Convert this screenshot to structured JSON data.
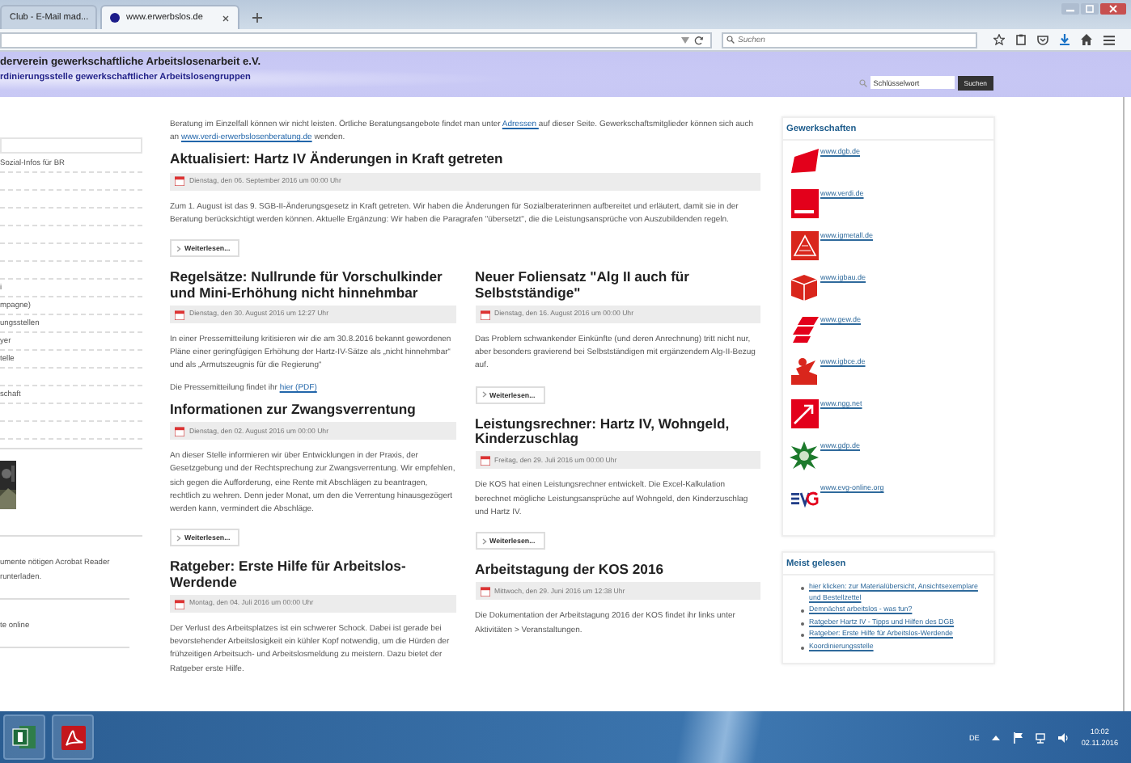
{
  "browser": {
    "tabs": [
      {
        "title": "Club - E-Mail mad...",
        "selected": false
      },
      {
        "title": "www.erwerbslos.de",
        "selected": true
      }
    ],
    "search": {
      "placeholder": "Suchen"
    }
  },
  "header": {
    "title": "derverein gewerkschaftliche Arbeitslosenarbeit e.V.",
    "subtitle": "rdinierungsstelle gewerkschaftlicher Arbeitslosengruppen",
    "search": {
      "value": "Schlüsselwort",
      "button": "Suchen"
    }
  },
  "sidebar": {
    "items": [
      {
        "kind": "field"
      },
      {
        "kind": "link",
        "text": "Sozial-Infos für BR"
      },
      {
        "kind": "blank"
      },
      {
        "kind": "blank"
      },
      {
        "kind": "blank"
      },
      {
        "kind": "blank"
      },
      {
        "kind": "blank"
      },
      {
        "kind": "blank"
      },
      {
        "kind": "link",
        "text": "i"
      },
      {
        "kind": "link",
        "text": "mpagne)"
      },
      {
        "kind": "link",
        "text": "ungsstellen"
      },
      {
        "kind": "link",
        "text": "yer"
      },
      {
        "kind": "link",
        "text": "telle"
      },
      {
        "kind": "blank"
      },
      {
        "kind": "link",
        "text": "schaft"
      },
      {
        "kind": "blank"
      },
      {
        "kind": "blank"
      },
      {
        "kind": "picture"
      },
      {
        "kind": "text",
        "text": "umente nötigen Acrobat Reader runterladen."
      },
      {
        "kind": "text",
        "text": "te online"
      }
    ]
  },
  "intro": [
    {
      "kind": "text",
      "text": "Beratung im Einzelfall können wir nicht leisten. Örtliche Beratungsangebote findet man unter "
    },
    {
      "kind": "link",
      "text": "Adressen "
    },
    {
      "kind": "text",
      "text": "auf dieser Seite. Gewerkschaftsmitglieder können sich auch an "
    },
    {
      "kind": "link",
      "text": "www.verdi-erwerbslosenberatung.de"
    },
    {
      "kind": "text",
      "text": " wenden."
    }
  ],
  "featured": {
    "title": "Aktualisiert: Hartz IV Änderungen in Kraft getreten",
    "date": "Dienstag, den 06. September 2016 um 00:00 Uhr",
    "body": [
      [
        {
          "kind": "text",
          "text": "Zum 1. August ist das 9. SGB-II-Änderungsgesetz in Kraft getreten. Wir haben die Änderungen für Sozialberaterinnen aufbereitet und erläutert, damit sie in der Beratung berücksichtigt werden können. Aktuelle Ergänzung: Wir haben die Paragrafen \"übersetzt\", die die Leistungsansprüche von Auszubildenden regeln."
        }
      ]
    ],
    "more": "Weiterlesen..."
  },
  "left_column": [
    {
      "title": "Regelsätze: Nullrunde für Vorschulkinder und Mini-Erhöhung nicht hinnehmbar",
      "date": "Dienstag, den 30. August 2016 um 12:27 Uhr",
      "body": [
        [
          {
            "kind": "text",
            "text": "In einer Pressemitteilung kritisieren wir die am 30.8.2016 bekannt gewordenen Pläne einer geringfügigen Erhöhung der Hartz-IV-Sätze als „nicht hinnehmbar“ und als „Armutszeugnis für die Regierung“"
          }
        ],
        [
          {
            "kind": "text",
            "text": "Die Pressemitteilung findet ihr "
          },
          {
            "kind": "link",
            "text": "hier (PDF)"
          }
        ]
      ]
    },
    {
      "title": "Informationen zur Zwangsverrentung",
      "date": "Dienstag, den 02. August 2016 um 00:00 Uhr",
      "body": [
        [
          {
            "kind": "text",
            "text": "An dieser Stelle informieren wir über Entwicklungen in der Praxis, der Gesetzgebung und der Rechtsprechung zur Zwangsverrentung. Wir empfehlen, sich gegen die Aufforderung, eine Rente mit Abschlägen zu beantragen, rechtlich zu wehren. Denn jeder Monat, um den die Verrentung hinausgezögert werden kann, vermindert die Abschläge."
          }
        ]
      ],
      "more": "Weiterlesen..."
    },
    {
      "title": "Ratgeber: Erste Hilfe für Arbeitslos-Werdende",
      "date": "Montag, den 04. Juli 2016 um 00:00 Uhr",
      "body": [
        [
          {
            "kind": "text",
            "text": "Der Verlust des Arbeitsplatzes ist ein schwerer Schock. Dabei ist gerade bei bevorstehender Arbeitslosigkeit ein kühler Kopf notwendig, um die Hürden der frühzeitigen Arbeitsuch- und Arbeitslosmeldung zu meistern. Dazu bietet der Ratgeber erste Hilfe."
          }
        ]
      ]
    }
  ],
  "right_column": [
    {
      "title": "Neuer Foliensatz \"Alg II auch für Selbstständige\"",
      "date": "Dienstag, den 16. August 2016 um 00:00 Uhr",
      "body": [
        [
          {
            "kind": "text",
            "text": "Das Problem schwankender Einkünfte (und deren Anrechnung) tritt nicht nur, aber besonders gravierend bei Selbstständigen mit ergänzendem Alg-II-Bezug auf."
          }
        ]
      ],
      "more": "Weiterlesen..."
    },
    {
      "title": "Leistungsrechner: Hartz IV, Wohngeld, Kinderzuschlag",
      "date": "Freitag, den 29. Juli 2016 um 00:00 Uhr",
      "body": [
        [
          {
            "kind": "text",
            "text": "Die KOS hat einen Leistungsrechner entwickelt. Die Excel-Kalkulation berechnet mögliche Leistungsansprüche auf Wohngeld, den Kinderzuschlag und Hartz IV."
          }
        ]
      ],
      "more": "Weiterlesen..."
    },
    {
      "title": "Arbeitstagung der KOS 2016",
      "date": "Mittwoch, den 29. Juni 2016 um 12:38 Uhr",
      "body": [
        [
          {
            "kind": "text",
            "text": "Die Dokumentation der Arbeitstagung 2016 der KOS findet ihr links unter Aktivitäten > Veranstaltungen."
          }
        ]
      ]
    }
  ],
  "unions": {
    "title": "Gewerkschaften",
    "links": [
      {
        "kind": "dgb",
        "text": "www.dgb.de"
      },
      {
        "kind": "verdi",
        "text": "www.verdi.de"
      },
      {
        "kind": "igmetall",
        "text": "www.igmetall.de"
      },
      {
        "kind": "igbau",
        "text": "www.igbau.de"
      },
      {
        "kind": "gew",
        "text": "www.gew.de"
      },
      {
        "kind": "igbce",
        "text": "www.igbce.de"
      },
      {
        "kind": "ngg",
        "text": "www.ngg.net"
      },
      {
        "kind": "gdp",
        "text": "www.gdp.de"
      },
      {
        "kind": "evg",
        "text": "www.evg-online.org"
      }
    ]
  },
  "most_read": {
    "title": "Meist gelesen",
    "items": [
      "hier klicken: zur Materialübersicht, Ansichtsexemplare und Bestellzettel",
      "Demnächst arbeitslos - was tun?",
      "Ratgeber Hartz IV - Tipps und Hilfen des DGB",
      "Ratgeber: Erste Hilfe für Arbeitslos-Werdende",
      "Koordinierungsstelle"
    ]
  },
  "taskbar": {
    "apps": [
      {
        "kind": "project"
      },
      {
        "kind": "acrobat"
      }
    ],
    "language": "DE",
    "time": "10:02",
    "date": "02.11.2016"
  }
}
